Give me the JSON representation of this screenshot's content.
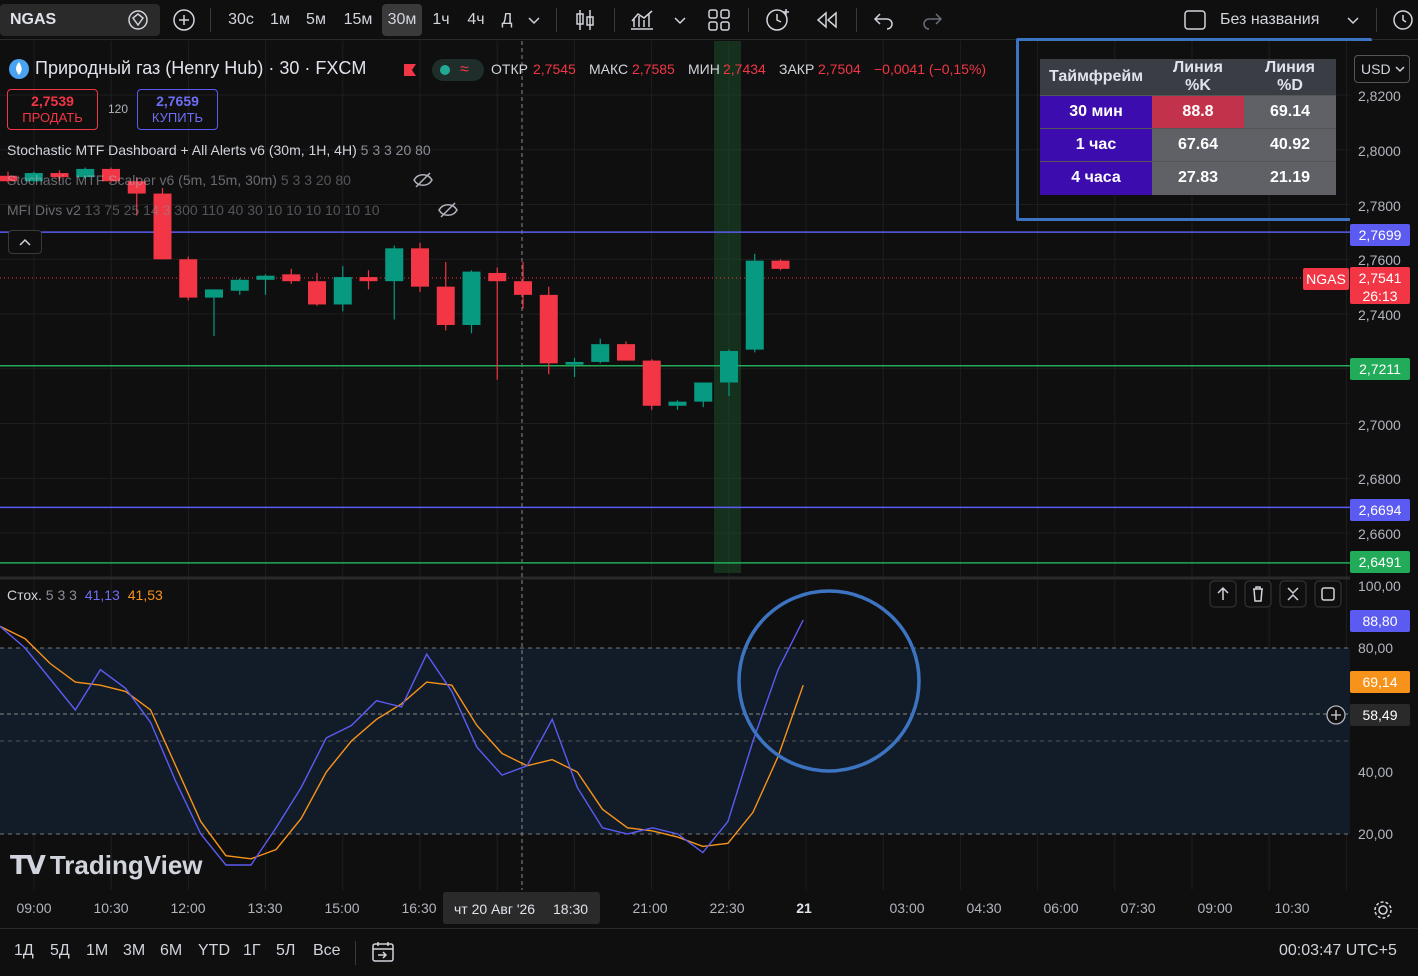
{
  "toolbar": {
    "symbol": "NGAS",
    "intervals": [
      "30с",
      "1м",
      "5м",
      "15м",
      "30м",
      "1ч",
      "4ч",
      "Д"
    ],
    "active_interval": "30м",
    "layout_name": "Без названия"
  },
  "legend": {
    "title": "Природный газ (Henry Hub) · 30 · FXCM",
    "open_label": "ОТКР",
    "open": "2,7545",
    "high_label": "МАКС",
    "high": "2,7585",
    "low_label": "МИН",
    "low": "2,7434",
    "close_label": "ЗАКР",
    "close": "2,7504",
    "change": "−0,0041 (−0,15%)",
    "sell_price": "2,7539",
    "sell_label": "ПРОДАТЬ",
    "spread": "120",
    "buy_price": "2,7659",
    "buy_label": "КУПИТЬ",
    "indicators": [
      {
        "name": "Stochastic MTF Dashboard + All Alerts v6 (30m, 1H, 4H)",
        "params": "5 3 3 20 80"
      },
      {
        "name": "Stochastic MTF Scalper v6 (5m, 15m, 30m)",
        "params": "5 3 3 20 80"
      },
      {
        "name": "MFI Divs v2",
        "params": "13 75 25 14 3 300 110 40 30 10 10 10 10 10 10"
      }
    ]
  },
  "dashboard": {
    "headers": [
      "Таймфрейм",
      "Линия %K",
      "Линия %D"
    ],
    "rows": [
      {
        "tf": "30 мин",
        "k": "88.8",
        "d": "69.14"
      },
      {
        "tf": "1 час",
        "k": "67.64",
        "d": "40.92"
      },
      {
        "tf": "4 часа",
        "k": "27.83",
        "d": "21.19"
      }
    ]
  },
  "price_axis": {
    "currency": "USD",
    "labels": [
      "2,8200",
      "2,8000",
      "2,7800",
      "2,7600",
      "2,7400",
      "2,7000",
      "2,6800",
      "2,6600"
    ],
    "badges": [
      {
        "text": "2,7699",
        "color": "#5b5bf2"
      },
      {
        "text": "2,7541",
        "color": "#f23645"
      },
      {
        "text": "26:13",
        "color": "#f23645"
      },
      {
        "text": "2,7211",
        "color": "#22ab58"
      },
      {
        "text": "2,6694",
        "color": "#5b5bf2"
      },
      {
        "text": "2,6491",
        "color": "#22ab58"
      }
    ],
    "symbol_tag": "NGAS"
  },
  "stoch": {
    "label": "Стох.",
    "params": "5 3 3",
    "k": "41,13",
    "d": "41,53",
    "axis_labels": [
      "100,00",
      "80,00",
      "40,00",
      "20,00"
    ],
    "badge_k": "88,80",
    "badge_d": "69,14",
    "crosshair_value": "58,49"
  },
  "time_axis": {
    "labels": [
      "09:00",
      "10:30",
      "12:00",
      "13:30",
      "15:00",
      "16:30",
      "21:00",
      "22:30",
      "21",
      "03:00",
      "04:30",
      "06:00",
      "07:30",
      "09:00",
      "10:30"
    ],
    "crosshair_date": "чт 20 Авг '26",
    "crosshair_time": "18:30"
  },
  "bottom": {
    "ranges": [
      "1Д",
      "5Д",
      "1М",
      "3М",
      "6М",
      "YTD",
      "1Г",
      "5Л",
      "Все"
    ],
    "clock": "00:03:47 UTC+5"
  },
  "watermark": "TradingView",
  "chart_data": {
    "type": "candlestick",
    "candles": [
      {
        "o": 2.7905,
        "h": 2.792,
        "l": 2.788,
        "c": 2.7885
      },
      {
        "o": 2.7885,
        "h": 2.792,
        "l": 2.788,
        "c": 2.7915
      },
      {
        "o": 2.7915,
        "h": 2.7925,
        "l": 2.7885,
        "c": 2.79
      },
      {
        "o": 2.79,
        "h": 2.7935,
        "l": 2.7895,
        "c": 2.793
      },
      {
        "o": 2.793,
        "h": 2.7935,
        "l": 2.788,
        "c": 2.7885
      },
      {
        "o": 2.7885,
        "h": 2.79,
        "l": 2.776,
        "c": 2.784
      },
      {
        "o": 2.784,
        "h": 2.786,
        "l": 2.76,
        "c": 2.76
      },
      {
        "o": 2.76,
        "h": 2.761,
        "l": 2.745,
        "c": 2.746
      },
      {
        "o": 2.746,
        "h": 2.749,
        "l": 2.732,
        "c": 2.749
      },
      {
        "o": 2.7485,
        "h": 2.753,
        "l": 2.747,
        "c": 2.7525
      },
      {
        "o": 2.7525,
        "h": 2.7545,
        "l": 2.747,
        "c": 2.754
      },
      {
        "o": 2.7545,
        "h": 2.7565,
        "l": 2.751,
        "c": 2.752
      },
      {
        "o": 2.752,
        "h": 2.755,
        "l": 2.743,
        "c": 2.7435
      },
      {
        "o": 2.7435,
        "h": 2.7575,
        "l": 2.741,
        "c": 2.7535
      },
      {
        "o": 2.7535,
        "h": 2.756,
        "l": 2.749,
        "c": 2.752
      },
      {
        "o": 2.752,
        "h": 2.765,
        "l": 2.738,
        "c": 2.764
      },
      {
        "o": 2.764,
        "h": 2.766,
        "l": 2.748,
        "c": 2.75
      },
      {
        "o": 2.75,
        "h": 2.759,
        "l": 2.734,
        "c": 2.736
      },
      {
        "o": 2.736,
        "h": 2.756,
        "l": 2.733,
        "c": 2.7555
      },
      {
        "o": 2.755,
        "h": 2.757,
        "l": 2.716,
        "c": 2.752
      },
      {
        "o": 2.752,
        "h": 2.759,
        "l": 2.742,
        "c": 2.747
      },
      {
        "o": 2.747,
        "h": 2.75,
        "l": 2.718,
        "c": 2.722
      },
      {
        "o": 2.7215,
        "h": 2.724,
        "l": 2.717,
        "c": 2.7225
      },
      {
        "o": 2.7225,
        "h": 2.731,
        "l": 2.722,
        "c": 2.729
      },
      {
        "o": 2.729,
        "h": 2.73,
        "l": 2.723,
        "c": 2.723
      },
      {
        "o": 2.723,
        "h": 2.7235,
        "l": 2.705,
        "c": 2.7065
      },
      {
        "o": 2.7065,
        "h": 2.7085,
        "l": 2.705,
        "c": 2.708
      },
      {
        "o": 2.708,
        "h": 2.714,
        "l": 2.706,
        "c": 2.715
      },
      {
        "o": 2.715,
        "h": 2.727,
        "l": 2.71,
        "c": 2.7265
      },
      {
        "o": 2.727,
        "h": 2.762,
        "l": 2.726,
        "c": 2.7595
      },
      {
        "o": 2.7595,
        "h": 2.76,
        "l": 2.756,
        "c": 2.7565
      }
    ],
    "hlines": [
      {
        "y": 2.7699,
        "color": "#5b5bf2"
      },
      {
        "y": 2.7211,
        "color": "#22ab58"
      },
      {
        "y": 2.6694,
        "color": "#5b5bf2"
      },
      {
        "y": 2.6491,
        "color": "#22ab58"
      }
    ],
    "stoch_k": [
      87,
      80,
      70,
      60,
      73,
      67,
      56,
      37,
      20,
      10,
      10,
      22,
      35,
      51,
      55,
      63,
      61,
      78,
      66,
      48,
      39,
      42,
      57,
      35,
      22,
      20,
      22,
      20,
      14,
      24,
      50,
      73,
      89
    ],
    "stoch_d": [
      87,
      83,
      75,
      69,
      68,
      66,
      60,
      42,
      24,
      13,
      12,
      15,
      25,
      40,
      50,
      57,
      62,
      69,
      68,
      55,
      46,
      42,
      44,
      40,
      28,
      22,
      21,
      19,
      16,
      17,
      27,
      45,
      68
    ]
  }
}
